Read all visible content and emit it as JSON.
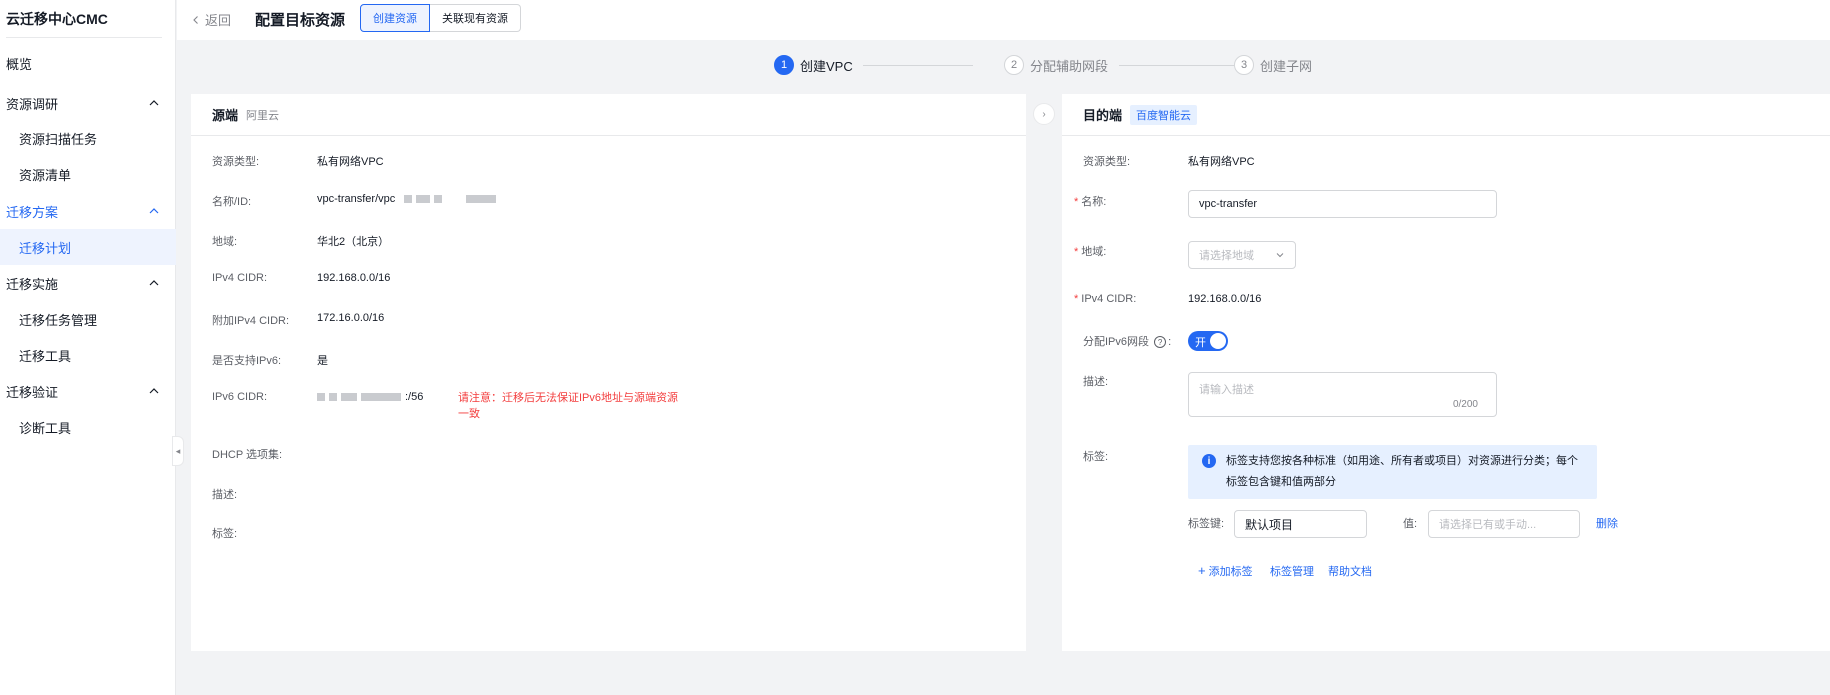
{
  "sidebar": {
    "app_title": "云迁移中心CMC",
    "items": [
      {
        "label": "概览"
      },
      {
        "label": "资源调研"
      },
      {
        "label": "资源扫描任务"
      },
      {
        "label": "资源清单"
      },
      {
        "label": "迁移方案"
      },
      {
        "label": "迁移计划"
      },
      {
        "label": "迁移实施"
      },
      {
        "label": "迁移任务管理"
      },
      {
        "label": "迁移工具"
      },
      {
        "label": "迁移验证"
      },
      {
        "label": "诊断工具"
      }
    ]
  },
  "header": {
    "back_label": "返回",
    "page_title": "配置目标资源",
    "tabs": [
      {
        "label": "创建资源"
      },
      {
        "label": "关联现有资源"
      }
    ]
  },
  "steps": [
    {
      "num": "1",
      "label": "创建VPC"
    },
    {
      "num": "2",
      "label": "分配辅助网段"
    },
    {
      "num": "3",
      "label": "创建子网"
    }
  ],
  "source": {
    "title": "源端",
    "provider": "阿里云",
    "fields": [
      {
        "label": "资源类型:",
        "value": "私有网络VPC"
      },
      {
        "label": "名称/ID:",
        "value": "vpc-transfer/vpc"
      },
      {
        "label": "地域:",
        "value": "华北2（北京）"
      },
      {
        "label": "IPv4 CIDR:",
        "value": "192.168.0.0/16"
      },
      {
        "label": "附加IPv4 CIDR:",
        "value": "172.16.0.0/16"
      },
      {
        "label": "是否支持IPv6:",
        "value": "是"
      },
      {
        "label": "IPv6 CIDR:",
        "value": ":/56"
      },
      {
        "label": "DHCP 选项集:",
        "value": ""
      },
      {
        "label": "描述:",
        "value": ""
      },
      {
        "label": "标签:",
        "value": ""
      }
    ],
    "ipv6_warning": "请注意：迁移后无法保证IPv6地址与源端资源一致"
  },
  "target": {
    "title": "目的端",
    "provider": "百度智能云",
    "resource_type_label": "资源类型:",
    "resource_type_value": "私有网络VPC",
    "name_label": "名称:",
    "name_value": "vpc-transfer",
    "region_label": "地域:",
    "region_placeholder": "请选择地域",
    "ipv4_label": "IPv4 CIDR:",
    "ipv4_value": "192.168.0.0/16",
    "ipv6_label": "分配IPv6网段",
    "ipv6_colon": ":",
    "ipv6_toggle": "开",
    "desc_label": "描述:",
    "desc_placeholder": "请输入描述",
    "desc_counter": "0/200",
    "tags_label": "标签:",
    "tags_info": "标签支持您按各种标准（如用途、所有者或项目）对资源进行分类；每个标签包含键和值两部分",
    "tag_key_label": "标签键:",
    "tag_key_value": "默认项目",
    "tag_value_label": "值:",
    "tag_value_placeholder": "请选择已有或手动...",
    "delete_label": "删除",
    "add_tag_label": "添加标签",
    "tag_manage_label": "标签管理",
    "help_doc_label": "帮助文档"
  },
  "colors": {
    "accent": "#2468f2",
    "danger": "#f33e3e",
    "text": "#151b26",
    "muted": "#84868c"
  }
}
